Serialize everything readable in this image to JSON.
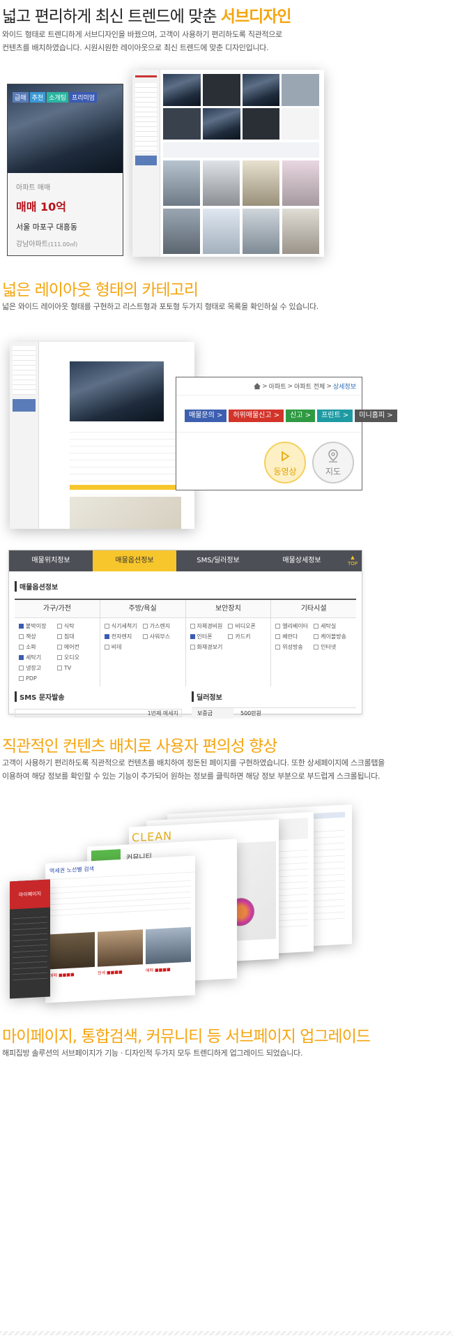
{
  "section1": {
    "title_plain": "넓고 편리하게 최신 트렌드에 맞춘 ",
    "title_highlight": "서브디자인",
    "desc_line1": "와이드 형태로 트렌디하게 서브디자인을 바꿨으며, 고객이 사용하기 편리하도록 직관적으로",
    "desc_line2": "컨텐츠를 배치하였습니다. 시원시원한 레이아웃으로 최신 트렌드에 맞춘 디자인입니다.",
    "card": {
      "tags": [
        "급매",
        "추천",
        "소개팅",
        "프리미엄"
      ],
      "type": "아파트 매매",
      "price": "매매 10억",
      "location": "서울 마포구 대흥동",
      "name": "강남아파트",
      "area": "(111.00㎡)"
    }
  },
  "section2": {
    "title": "넓은 레이아웃 형태의 카테고리",
    "desc": "넓은 와이드 레이아웃 형태를 구현하고 리스트형과 포토형 두가지 형태로 목록을 확인하실 수 있습니다.",
    "breadcrumb": [
      ">",
      "아파트",
      ">",
      "아파트 전체",
      ">",
      "상세정보"
    ],
    "buttons": [
      {
        "label": "매물문의 >",
        "color": "#3d5fb0"
      },
      {
        "label": "허위매물신고 >",
        "color": "#d2342a"
      },
      {
        "label": "신고 >",
        "color": "#2f9a43"
      },
      {
        "label": "프린트 >",
        "color": "#1e9aa3"
      },
      {
        "label": "미니홈피 >",
        "color": "#555555"
      }
    ],
    "video_label": "동영상",
    "map_label": "지도"
  },
  "section3": {
    "tabs": [
      "매물위치정보",
      "매물옵션정보",
      "SMS/딜러정보",
      "매물상세정보"
    ],
    "top_label": "TOP",
    "options_title": "매물옵션정보",
    "columns": [
      {
        "head": "가구/가전",
        "items": [
          {
            "label": "붙박이장",
            "on": true
          },
          {
            "label": "식탁",
            "on": false
          },
          {
            "label": "책상",
            "on": false
          },
          {
            "label": "침대",
            "on": false
          },
          {
            "label": "소파",
            "on": false
          },
          {
            "label": "에어컨",
            "on": false
          },
          {
            "label": "세탁기",
            "on": true
          },
          {
            "label": "오디오",
            "on": false
          },
          {
            "label": "냉장고",
            "on": false
          },
          {
            "label": "TV",
            "on": false
          },
          {
            "label": "PDP",
            "on": false
          }
        ]
      },
      {
        "head": "주방/욕실",
        "items": [
          {
            "label": "식기세척기",
            "on": false
          },
          {
            "label": "가스렌지",
            "on": false
          },
          {
            "label": "전자렌지",
            "on": true
          },
          {
            "label": "샤워부스",
            "on": false
          },
          {
            "label": "비데",
            "on": false
          }
        ]
      },
      {
        "head": "보안장치",
        "items": [
          {
            "label": "자체경비원",
            "on": false
          },
          {
            "label": "비디오폰",
            "on": false
          },
          {
            "label": "인터폰",
            "on": true
          },
          {
            "label": "카드키",
            "on": false
          },
          {
            "label": "화재경보기",
            "on": false
          }
        ]
      },
      {
        "head": "기타시설",
        "items": [
          {
            "label": "엘리베이터",
            "on": false
          },
          {
            "label": "세탁실",
            "on": false
          },
          {
            "label": "베란다",
            "on": false
          },
          {
            "label": "케이블방송",
            "on": false
          },
          {
            "label": "위성방송",
            "on": false
          },
          {
            "label": "인터넷",
            "on": false
          }
        ]
      }
    ],
    "sms_title": "SMS 문자발송",
    "sms_counter": "1번째 메세지",
    "dealer_title": "딜러정보",
    "deposit_label": "보증금",
    "deposit_value": "500만원"
  },
  "section4": {
    "title": "직관적인 컨텐츠 배치로 사용자 편의성 향상",
    "desc_line1": "고객이 사용하기 편리하도록 직관적으로 컨텐츠를 배치하여 정돈된 페이지를 구현하였습니다. 또한 상세페이지에 스크롤탭을",
    "desc_line2": "이용하여 해당 정보를 확인할 수 있는 기능이 추가되어 원하는 정보를 클릭하면 해당 정보 부분으로 부드럽게 스크롤됩니다.",
    "clean_label": "CLEAN",
    "community_label": "커뮤니티",
    "mypage_label": "마이페이지",
    "search_title": "역세권 노선별 검색"
  },
  "section5": {
    "title": "마이페이지, 통합검색, 커뮤니티 등 서브페이지 업그레이드",
    "desc": "해피집방 솔루션의 서브페이지가 기능 · 디자인적 두가지 모두 트렌디하게 업그레이드 되었습니다."
  },
  "colors": {
    "accent": "#f5a50f",
    "dark": "#4c4f56",
    "price_red": "#d01818"
  },
  "icons": {
    "home": "home-icon",
    "play": "play-icon",
    "map_pin": "map-pin-icon",
    "arrow": "chevron-icon"
  }
}
